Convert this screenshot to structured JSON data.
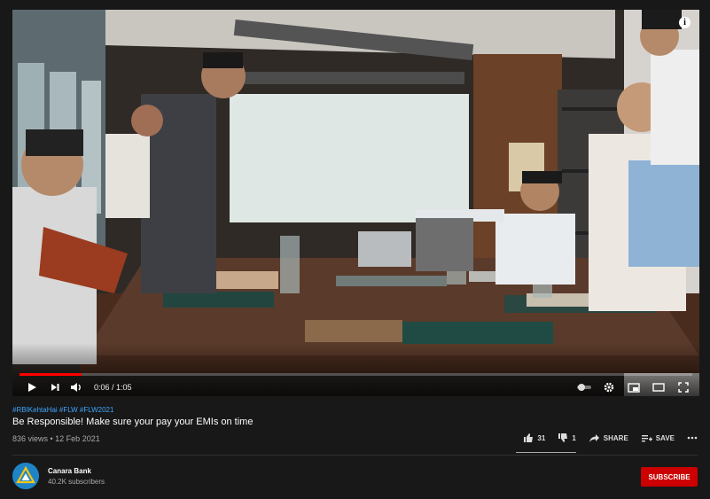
{
  "player": {
    "time_display": "0:06 / 1:05",
    "progress": 0.092,
    "info_icon": "i"
  },
  "video": {
    "hashtags": "#RBIKehtaHai #FLW #FLW2021",
    "title": "Be Responsible! Make sure your pay your EMIs on time",
    "meta": "836 views • 12 Feb 2021"
  },
  "actions": {
    "likes": "31",
    "dislikes": "1",
    "share_label": "SHARE",
    "save_label": "SAVE"
  },
  "channel": {
    "name": "Canara Bank",
    "subscribers": "40.2K subscribers",
    "subscribe_label": "SUBSCRIBE"
  },
  "colors": {
    "brand_red": "#cc0000",
    "link_blue": "#3ea6ff",
    "progress_red": "#ff0000"
  },
  "icons": [
    "play-icon",
    "next-icon",
    "volume-icon",
    "autoplay-toggle-icon",
    "settings-icon",
    "miniplayer-icon",
    "theater-icon",
    "fullscreen-icon",
    "like-icon",
    "dislike-icon",
    "share-icon",
    "save-icon",
    "more-icon",
    "info-icon"
  ]
}
